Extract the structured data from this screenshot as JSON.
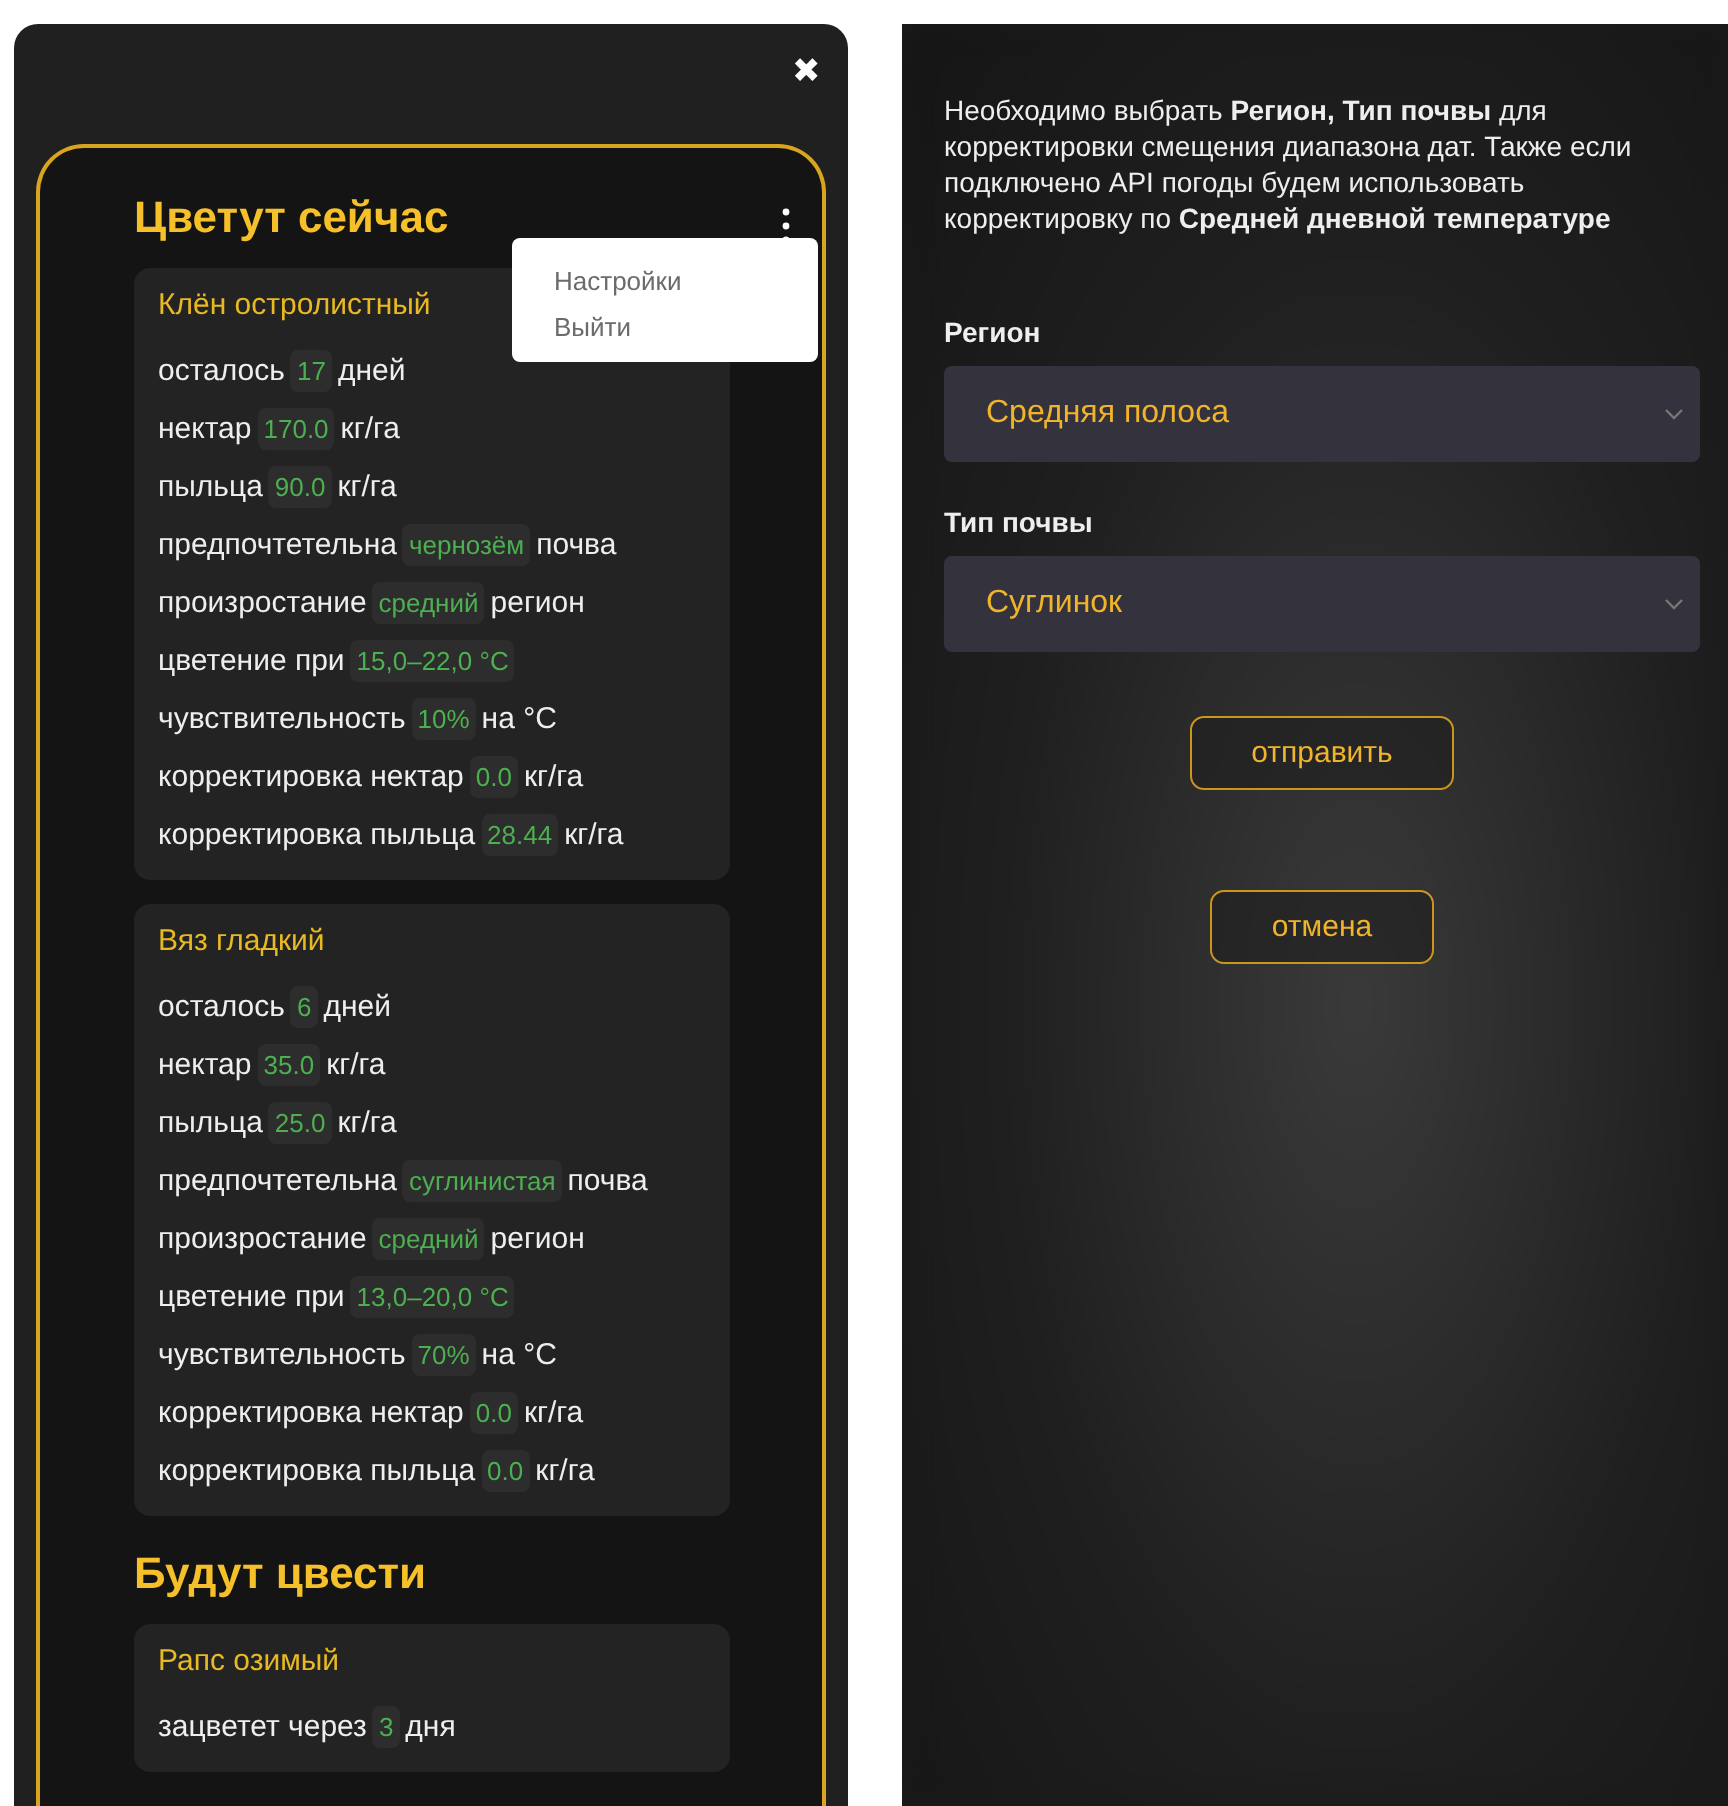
{
  "left_screen": {
    "close": "✖",
    "menu": {
      "open": true,
      "items": [
        {
          "label": "Настройки"
        },
        {
          "label": "Выйти"
        }
      ]
    },
    "sections": [
      {
        "title": "Цветут сейчас",
        "plants": [
          {
            "name": "Клён остролистный",
            "rows": [
              {
                "label": "осталось",
                "value": "17",
                "unit": "дней"
              },
              {
                "label": "нектар",
                "value": "170.0",
                "unit": "кг/га"
              },
              {
                "label": "пыльца",
                "value": "90.0",
                "unit": "кг/га"
              },
              {
                "label": "предпочтетельна",
                "value": "чернозём",
                "unit": "почва"
              },
              {
                "label": "произростание",
                "value": "средний",
                "unit": "регион"
              },
              {
                "label": "цветение при",
                "value": "15,0–22,0 °C"
              },
              {
                "label": "чувствительность",
                "value": "10%",
                "unit": "на °C"
              },
              {
                "label": "корректировка нектар",
                "value": "0.0",
                "unit": "кг/га"
              },
              {
                "label": "корректировка пыльца",
                "value": "28.44",
                "unit": "кг/га"
              }
            ]
          },
          {
            "name": "Вяз гладкий",
            "rows": [
              {
                "label": "осталось",
                "value": "6",
                "unit": "дней"
              },
              {
                "label": "нектар",
                "value": "35.0",
                "unit": "кг/га"
              },
              {
                "label": "пыльца",
                "value": "25.0",
                "unit": "кг/га"
              },
              {
                "label": "предпочтетельна",
                "value": "суглинистая",
                "unit": "почва"
              },
              {
                "label": "произростание",
                "value": "средний",
                "unit": "регион"
              },
              {
                "label": "цветение при",
                "value": "13,0–20,0 °C"
              },
              {
                "label": "чувствительность",
                "value": "70%",
                "unit": "на °C"
              },
              {
                "label": "корректировка нектар",
                "value": "0.0",
                "unit": "кг/га"
              },
              {
                "label": "корректировка пыльца",
                "value": "0.0",
                "unit": "кг/га"
              }
            ]
          }
        ]
      },
      {
        "title": "Будут цвести",
        "plants": [
          {
            "name": "Рапс озимый",
            "rows": [
              {
                "label": "зацветет через",
                "value": "3",
                "unit": "дня"
              }
            ]
          }
        ]
      }
    ]
  },
  "right_screen": {
    "description": "Необходимо выбрать **Регион, Тип почвы** для корректировки смещения диапазона дат. Также если подключено API погоды будем использовать корректировку по **Средней дневной температуре**",
    "fields": [
      {
        "label": "Регион",
        "value": "Средняя полоса"
      },
      {
        "label": "Тип почвы",
        "value": "Суглинок"
      }
    ],
    "buttons": [
      {
        "label": "отправить"
      },
      {
        "label": "отмена"
      }
    ]
  }
}
